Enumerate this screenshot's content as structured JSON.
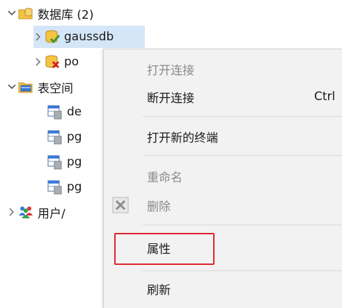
{
  "tree": {
    "database_group": {
      "label": "数据库 (2)",
      "icon": "database-folder-icon"
    },
    "databases": [
      {
        "label": "gaussdb",
        "icon": "database-connected-icon"
      },
      {
        "label": "po",
        "icon": "database-error-icon"
      }
    ],
    "tablespace_group": {
      "label": "表空间",
      "icon": "tablespace-folder-icon"
    },
    "tablespaces": [
      {
        "label": "de"
      },
      {
        "label": "pg"
      },
      {
        "label": "pg"
      },
      {
        "label": "pg"
      }
    ],
    "users_group": {
      "label": "用户/",
      "icon": "users-icon"
    }
  },
  "context_menu": {
    "open_connection": "打开连接",
    "disconnect": "断开连接",
    "disconnect_shortcut": "Ctrl",
    "open_new_terminal": "打开新的终端",
    "rename": "重命名",
    "delete": "删除",
    "properties": "属性",
    "refresh": "刷新"
  },
  "colors": {
    "selection": "#d4e6f8",
    "highlight_border": "#e0202a",
    "menu_background": "#f2f2f2",
    "disabled_text": "#8a8a8a"
  }
}
